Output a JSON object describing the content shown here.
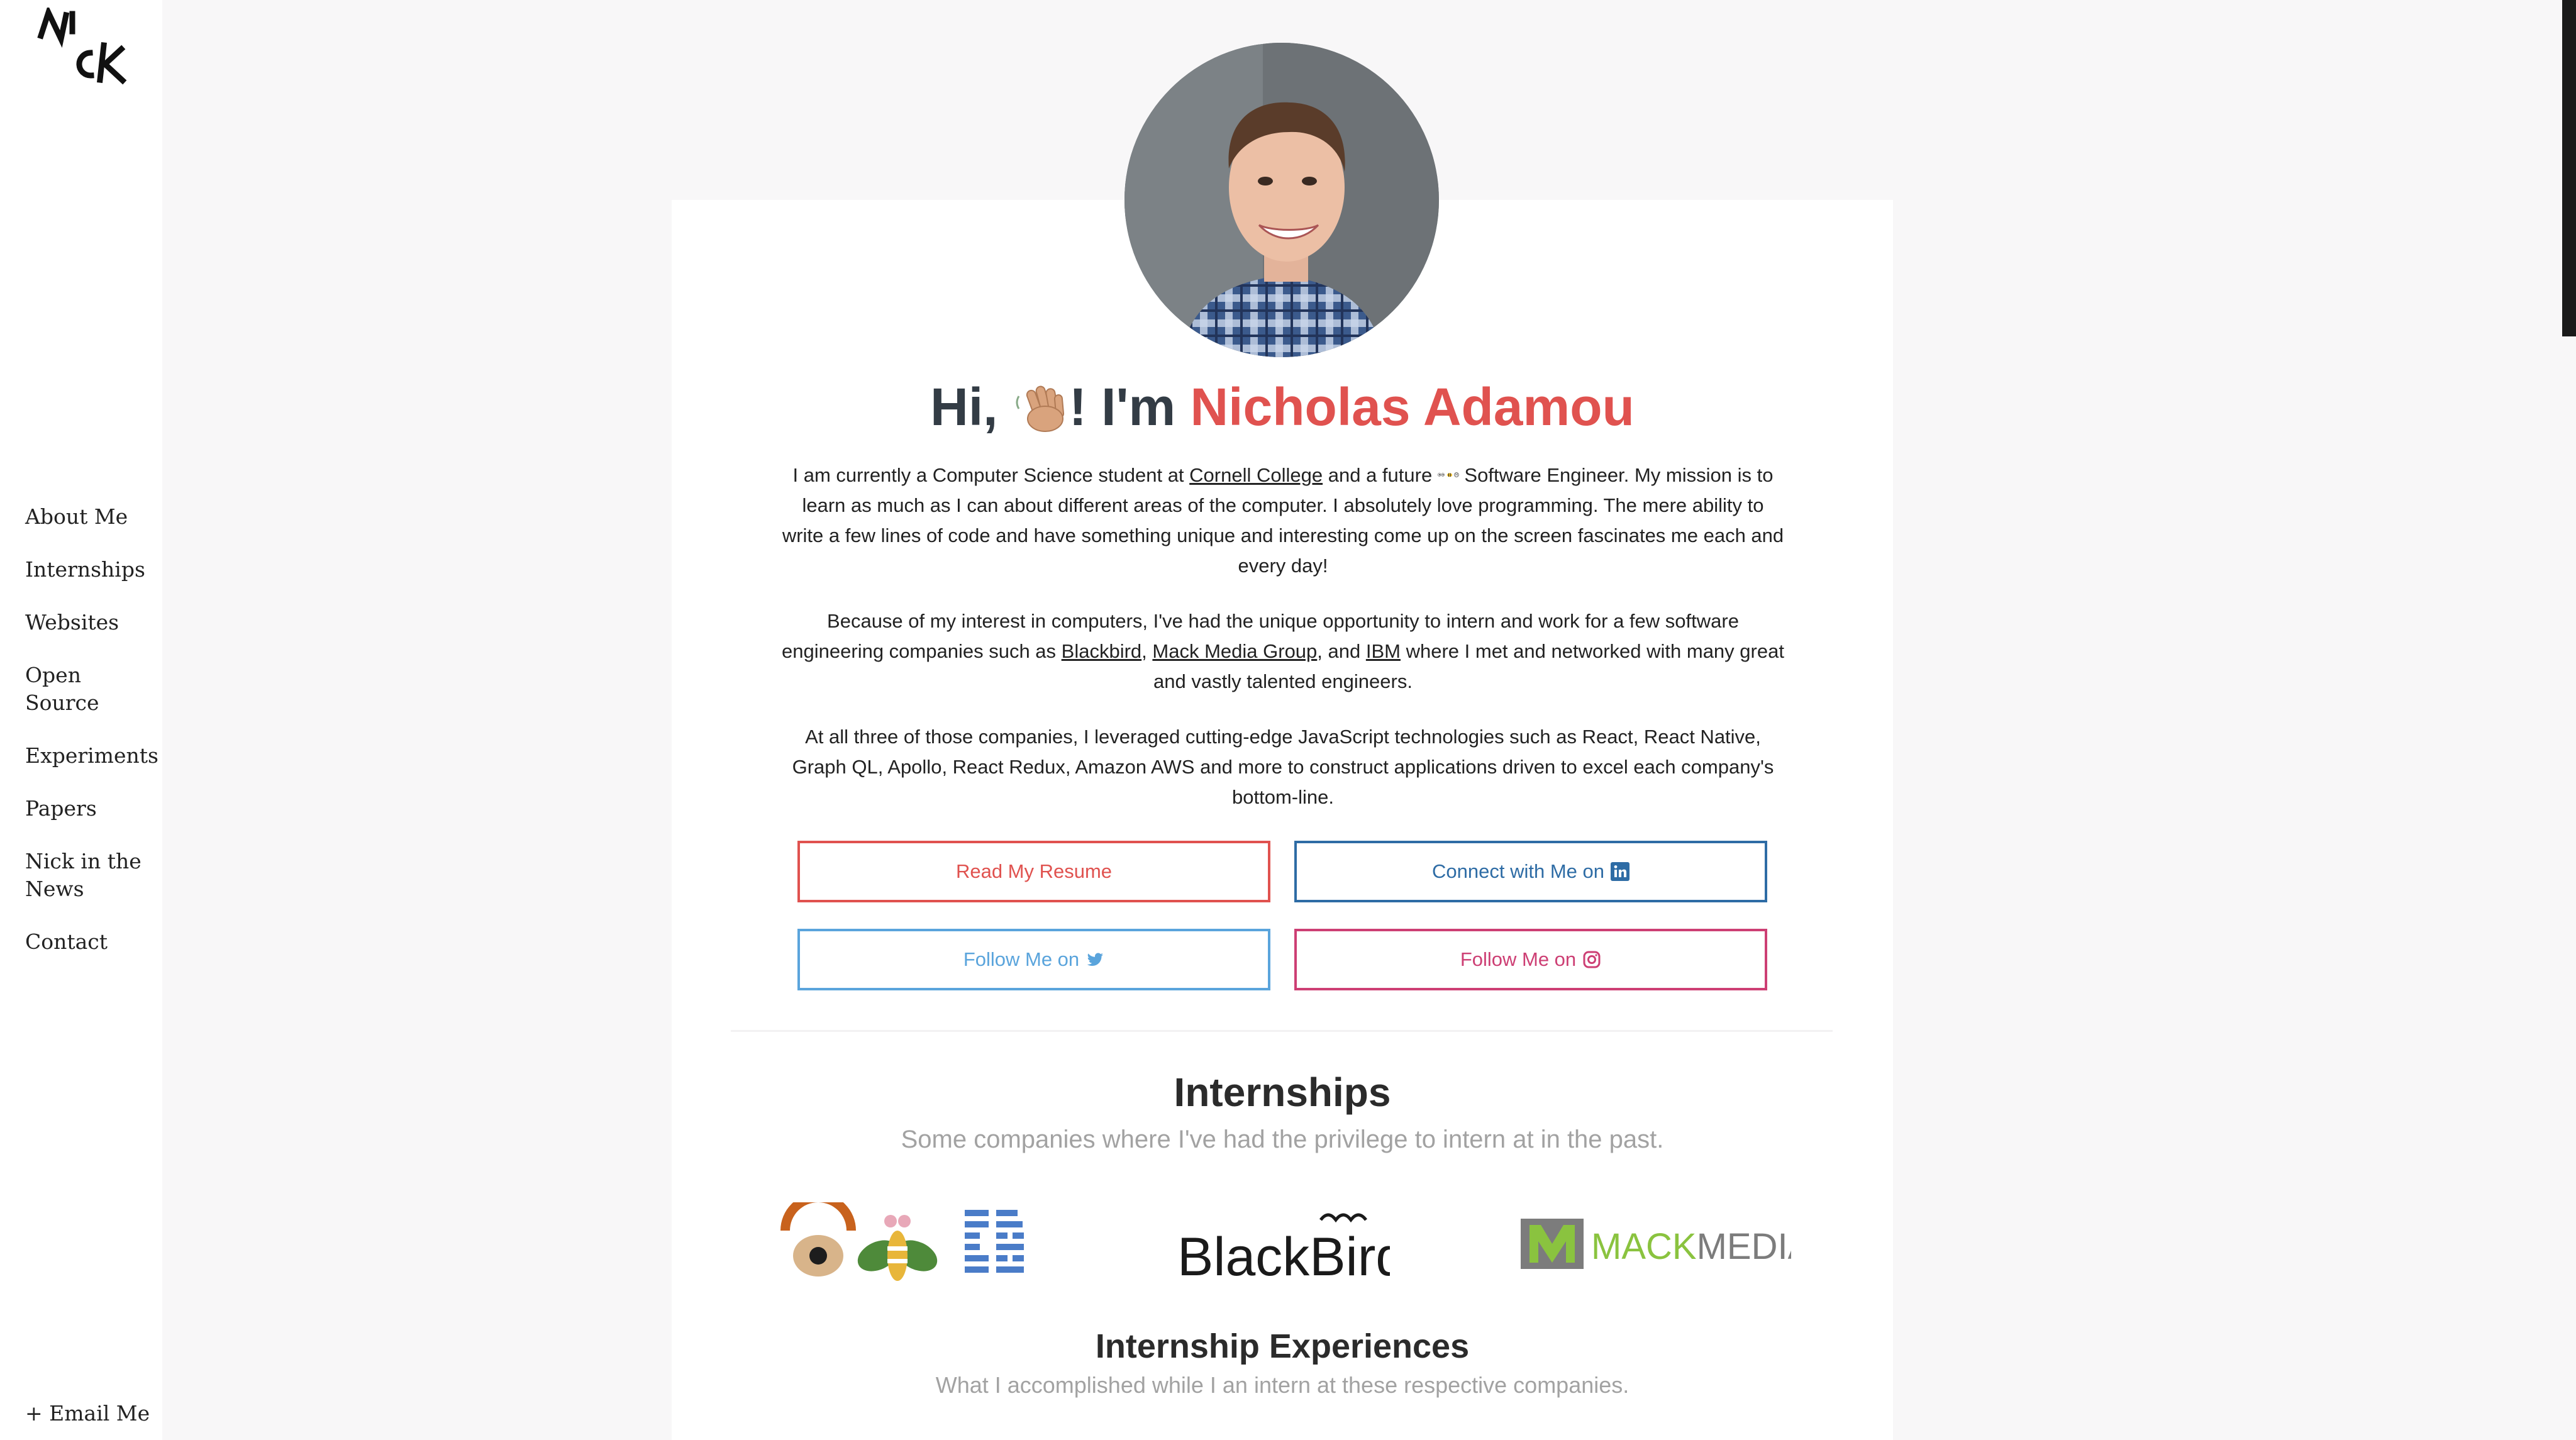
{
  "sidebar": {
    "logo_alt": "Nick",
    "nav": [
      "About Me",
      "Internships",
      "Websites",
      "Open Source",
      "Experiments",
      "Papers",
      "Nick in the News",
      "Contact"
    ],
    "email": "+ Email Me"
  },
  "hero": {
    "greeting_prefix": "Hi,",
    "greeting_mid": "! I'm",
    "name": "Nicholas Adamou",
    "p1_a": "I am currently a Computer Science student at ",
    "p1_link": "Cornell College",
    "p1_b": " and a future ",
    "p1_c": " Software Engineer. My mission is to learn as much as I can about different areas of the computer. I absolutely love programming. The mere ability to write a few lines of code and have something unique and interesting come up on the screen fascinates me each and every day!",
    "p2_a": "Because of my interest in computers, I've had the unique opportunity to intern and work for a few software engineering companies such as ",
    "p2_link1": "Blackbird",
    "p2_sep1": ", ",
    "p2_link2": "Mack Media Group",
    "p2_sep2": ", and ",
    "p2_link3": "IBM",
    "p2_b": " where I met and networked with many great and vastly talented engineers.",
    "p3": "At all three of those companies, I leveraged cutting-edge JavaScript technologies such as React, React Native, Graph QL, Apollo, React Redux, Amazon AWS and more to construct applications driven to excel each company's bottom-line."
  },
  "buttons": {
    "resume": "Read My Resume",
    "linkedin": "Connect with Me on",
    "twitter": "Follow Me on",
    "instagram": "Follow Me on"
  },
  "internships": {
    "title": "Internships",
    "subtitle": "Some companies where I've had the privilege to intern at in the past.",
    "logos": [
      "IBM",
      "BlackBird",
      "MACKMEDIA"
    ]
  },
  "experiences": {
    "title": "Internship Experiences",
    "subtitle": "What I accomplished while I an intern at these respective companies."
  },
  "colors": {
    "accent": "#e0524f",
    "linkedin": "#2e6ca5",
    "twitter": "#5aa4dc",
    "instagram": "#cd3f74"
  }
}
